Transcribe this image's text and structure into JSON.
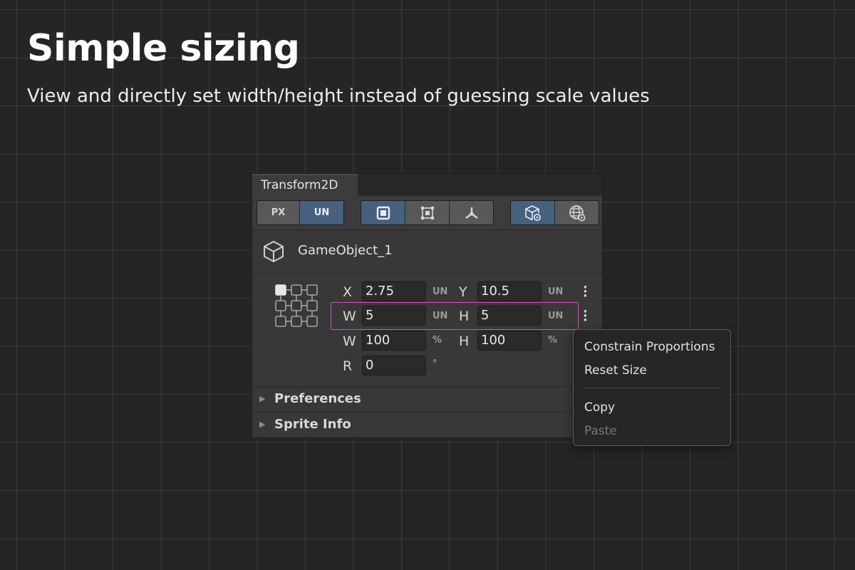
{
  "hero": {
    "title": "Simple sizing",
    "subtitle": "View and directly set width/height instead of guessing scale values"
  },
  "inspector": {
    "tab_label": "Transform2D",
    "unit_toggle": {
      "px": "PX",
      "un": "UN",
      "selected": "UN"
    },
    "mode_buttons": [
      "square-icon",
      "rect-transform-icon",
      "pivot-icon"
    ],
    "space_buttons": [
      "local-cube-icon",
      "world-globe-icon"
    ],
    "object_name": "GameObject_1",
    "fields": {
      "x_label": "X",
      "x_value": "2.75",
      "x_unit": "UN",
      "y_label": "Y",
      "y_value": "10.5",
      "y_unit": "UN",
      "w_label": "W",
      "w_value": "5",
      "w_unit": "UN",
      "h_label": "H",
      "h_value": "5",
      "h_unit": "UN",
      "wp_label": "W",
      "wp_value": "100",
      "wp_unit": "%",
      "hp_label": "H",
      "hp_value": "100",
      "hp_unit": "%",
      "r_label": "R",
      "r_value": "0",
      "r_unit": "°"
    },
    "foldouts": [
      "Preferences",
      "Sprite Info"
    ]
  },
  "context_menu": {
    "items": [
      "Constrain Proportions",
      "Reset Size",
      "Copy",
      "Paste"
    ],
    "disabled": [
      "Paste"
    ]
  },
  "colors": {
    "accent_blue": "#46607e",
    "highlight_pink": "#d250c8"
  }
}
